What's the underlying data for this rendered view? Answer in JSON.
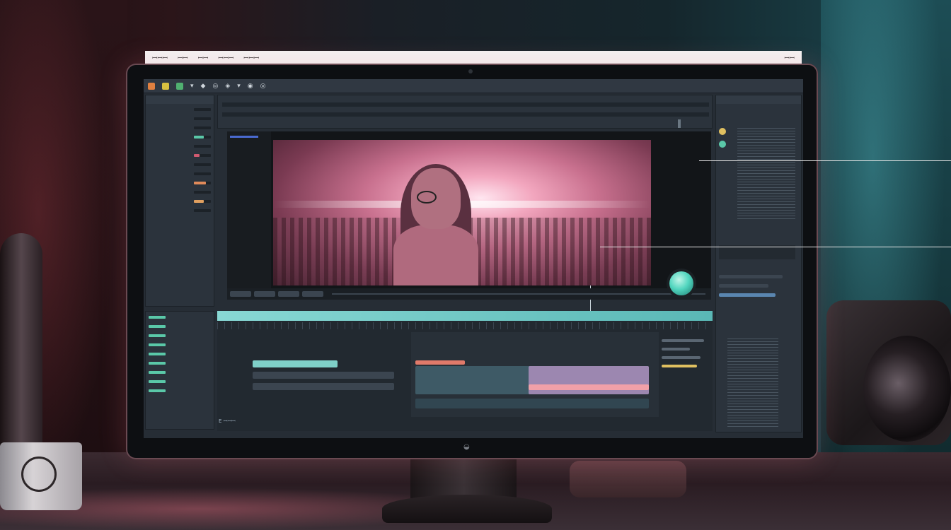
{
  "os_menubar": {
    "items": [
      "ꟷꟷꟷ",
      "ꟷꟷ",
      "ꟷꟷ",
      "ꟷꟷꟷ",
      "ꟷꟷꟷ"
    ],
    "right": "ꟷꟷ"
  },
  "app": {
    "toolbar_items": [
      "▾",
      "◆",
      "◎",
      "◈",
      "▾",
      "◉",
      "◎"
    ],
    "viewer_timecode": "",
    "status_bar": "E ꟷꟷꟷ"
  },
  "left_panel": {
    "title": "",
    "rows": [
      {
        "label": "",
        "value": 0.0,
        "color": "#5ac8a8"
      },
      {
        "label": "",
        "value": 0.0,
        "color": "#5ac8a8"
      },
      {
        "label": "",
        "value": 0.0,
        "color": "#5ac8a8"
      },
      {
        "label": "",
        "value": 0.6,
        "color": "#5ac8a8"
      },
      {
        "label": "",
        "value": 0.0,
        "color": "#5ac8a8"
      },
      {
        "label": "",
        "value": 0.35,
        "color": "#d05a70"
      },
      {
        "label": "",
        "value": 0.0,
        "color": "#5ac8a8"
      },
      {
        "label": "",
        "value": 0.0,
        "color": "#5ac8a8"
      },
      {
        "label": "",
        "value": 0.7,
        "color": "#e08a5a"
      },
      {
        "label": "",
        "value": 0.0,
        "color": "#5ac8a8"
      },
      {
        "label": "",
        "value": 0.6,
        "color": "#e0a060"
      },
      {
        "label": "",
        "value": 0.0,
        "color": "#5ac8a8"
      }
    ]
  },
  "bottom_left_panel": {
    "items": [
      "",
      "",
      "",
      "",
      "",
      "",
      "",
      "",
      ""
    ]
  },
  "timeline": {
    "tracks": [
      {
        "color": "#7fd0c8",
        "label": ""
      },
      {
        "color": "#e07a6a",
        "label": ""
      },
      {
        "color": "#c49ad0",
        "label": ""
      },
      {
        "color": "#9acfc6",
        "label": ""
      }
    ]
  },
  "right_panel": {
    "title": "",
    "swatches": [
      "#e0c060",
      "#5ac8a8",
      "#7a8fe0"
    ]
  },
  "colors": {
    "accent_teal": "#5ad6c0",
    "accent_pink": "#f2a6be",
    "accent_orange": "#e08a5a"
  }
}
